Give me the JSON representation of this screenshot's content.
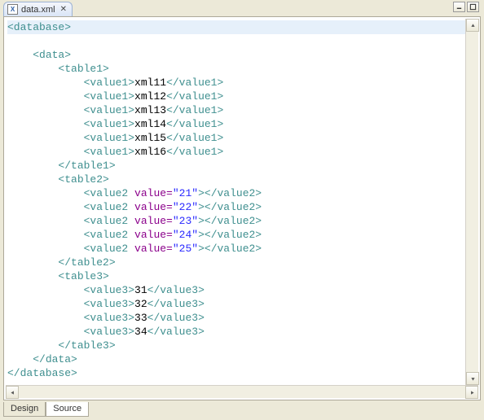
{
  "tab": {
    "filename": "data.xml"
  },
  "bottomTabs": {
    "design": "Design",
    "source": "Source"
  },
  "xml": {
    "root": "database",
    "dataTag": "data",
    "table1": {
      "name": "table1",
      "elem": "value1",
      "values": [
        "xml11",
        "xml12",
        "xml13",
        "xml14",
        "xml15",
        "xml16"
      ]
    },
    "table2": {
      "name": "table2",
      "elem": "value2",
      "attr": "value",
      "values": [
        "21",
        "22",
        "23",
        "24",
        "25"
      ]
    },
    "table3": {
      "name": "table3",
      "elem": "value3",
      "values": [
        "31",
        "32",
        "33",
        "34"
      ]
    }
  }
}
